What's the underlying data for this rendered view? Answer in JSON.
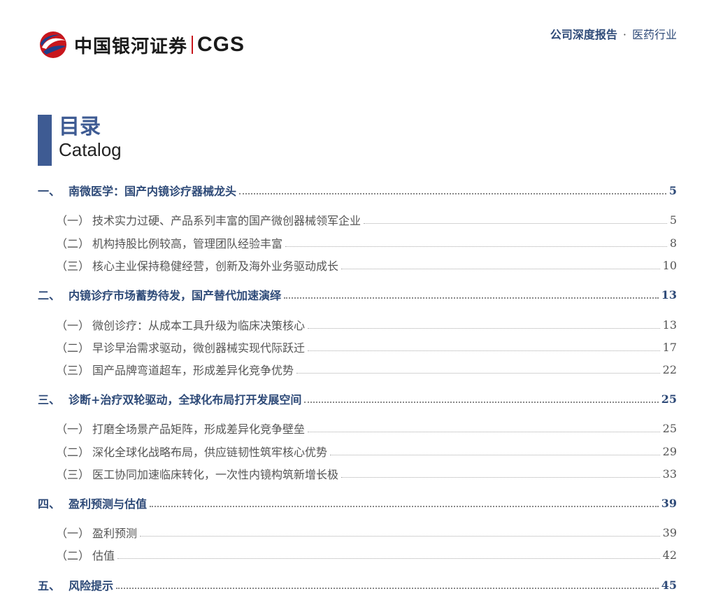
{
  "header": {
    "logo_cn": "中国银河证券",
    "logo_en": "CGS",
    "report_type": "公司深度报告",
    "separator": "·",
    "industry": "医药行业"
  },
  "title": {
    "cn": "目录",
    "en": "Catalog"
  },
  "toc": [
    {
      "level": 1,
      "num": "一、",
      "label": "南微医学：国产内镜诊疗器械龙头",
      "page": "5"
    },
    {
      "level": 2,
      "num": "（一）",
      "label": "技术实力过硬、产品系列丰富的国产微创器械领军企业",
      "page": "5"
    },
    {
      "level": 2,
      "num": "（二）",
      "label": "机构持股比例较高，管理团队经验丰富",
      "page": "8"
    },
    {
      "level": 2,
      "num": "（三）",
      "label": "核心主业保持稳健经营，创新及海外业务驱动成长",
      "page": "10"
    },
    {
      "level": 1,
      "num": "二、",
      "label": "内镜诊疗市场蓄势待发，国产替代加速演绎",
      "page": "13"
    },
    {
      "level": 2,
      "num": "（一）",
      "label": "微创诊疗：从成本工具升级为临床决策核心",
      "page": "13"
    },
    {
      "level": 2,
      "num": "（二）",
      "label": "早诊早治需求驱动，微创器械实现代际跃迁",
      "page": "17"
    },
    {
      "level": 2,
      "num": "（三）",
      "label": "国产品牌弯道超车，形成差异化竞争优势",
      "page": "22"
    },
    {
      "level": 1,
      "num": "三、",
      "label": "诊断+治疗双轮驱动，全球化布局打开发展空间",
      "page": "25"
    },
    {
      "level": 2,
      "num": "（一）",
      "label": "打磨全场景产品矩阵，形成差异化竞争壁垒",
      "page": "25"
    },
    {
      "level": 2,
      "num": "（二）",
      "label": "深化全球化战略布局，供应链韧性筑牢核心优势",
      "page": "29"
    },
    {
      "level": 2,
      "num": "（三）",
      "label": "医工协同加速临床转化，一次性内镜构筑新增长极",
      "page": "33"
    },
    {
      "level": 1,
      "num": "四、",
      "label": "盈利预测与估值",
      "page": "39"
    },
    {
      "level": 2,
      "num": "（一）",
      "label": "盈利预测",
      "page": "39"
    },
    {
      "level": 2,
      "num": "（二）",
      "label": "估值",
      "page": "42"
    },
    {
      "level": 1,
      "num": "五、",
      "label": "风险提示",
      "page": "45"
    }
  ],
  "colors": {
    "accent": "#3e5b93",
    "heading": "#2e4a78",
    "logo_red": "#c8161d"
  }
}
